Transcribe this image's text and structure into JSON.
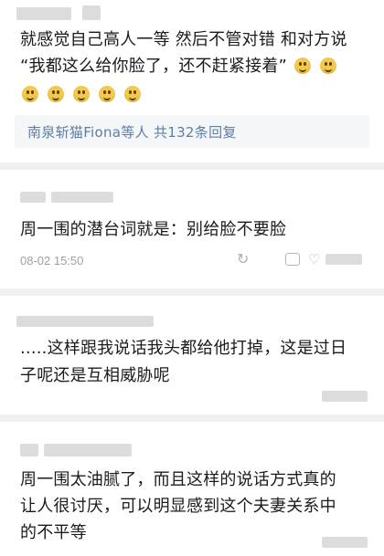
{
  "comments": [
    {
      "lines": [
        "就感觉自己高人一等 然后不管对错 和对方说",
        "“我都这么给你脸了，还不赶紧接着”"
      ],
      "replies_summary": "南泉斩猫Fiona等人 共132条回复"
    },
    {
      "text": "周一围的潜台词就是：别给脸不要脸",
      "timestamp": "08-02 15:50"
    },
    {
      "lines": [
        ".....这样跟我说话我头都给他打掉，这是过日",
        "子呢还是互相威胁呢"
      ]
    },
    {
      "lines": [
        "周一围太油腻了，而且这样的说话方式真的",
        "让人很讨厌，可以明显感到这个夫妻关系中",
        "的不平等"
      ]
    }
  ],
  "icons": [
    "smile-emoji-icon",
    "forward-icon",
    "comment-icon",
    "like-icon"
  ],
  "colors": {
    "link": "#5b7ea6",
    "meta": "#a0a0a0",
    "separator": "#f0f0f2"
  }
}
